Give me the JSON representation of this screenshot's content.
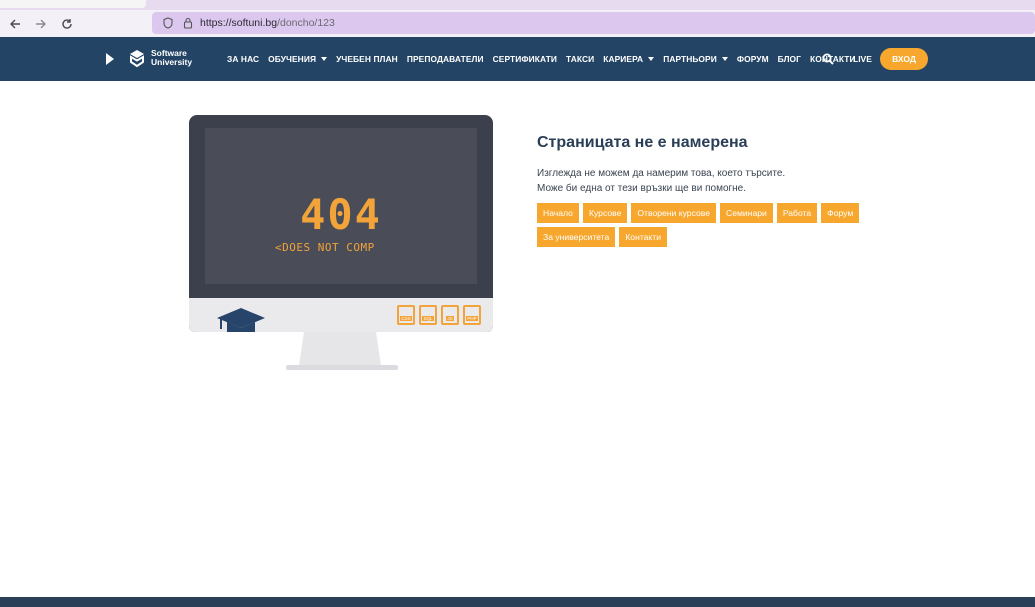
{
  "browser": {
    "url_host": "https://softuni.bg",
    "url_path": "/doncho/123"
  },
  "header": {
    "logo_line1": "Software",
    "logo_line2": "University",
    "nav": [
      {
        "label": "ЗА НАС",
        "dropdown": false
      },
      {
        "label": "ОБУЧЕНИЯ",
        "dropdown": true
      },
      {
        "label": "УЧЕБЕН ПЛАН",
        "dropdown": false
      },
      {
        "label": "ПРЕПОДАВАТЕЛИ",
        "dropdown": false
      },
      {
        "label": "СЕРТИФИКАТИ",
        "dropdown": false
      },
      {
        "label": "ТАКСИ",
        "dropdown": false
      },
      {
        "label": "КАРИЕРА",
        "dropdown": true
      },
      {
        "label": "ПАРТНЬОРИ",
        "dropdown": true
      },
      {
        "label": "ФОРУМ",
        "dropdown": false
      },
      {
        "label": "БЛОГ",
        "dropdown": false
      },
      {
        "label": "КОНТАКТИ",
        "dropdown": false
      }
    ],
    "live_label": "LIVE",
    "login_label": "ВХОД"
  },
  "illustration": {
    "code": "404",
    "subtext": "<DOES NOT COMP",
    "file_types": [
      "CSS",
      "SQL",
      "JS",
      "PHP"
    ]
  },
  "main": {
    "title": "Страницата не е намерена",
    "line1": "Изглежда не можем да намерим това, което търсите.",
    "line2": "Може би една от тези връзки ще ви помогне.",
    "links": [
      "Начало",
      "Курсове",
      "Отворени курсове",
      "Семинари",
      "Работа",
      "Форум",
      "За университета",
      "Контакти"
    ]
  },
  "colors": {
    "header_bg": "#234465",
    "accent": "#f7a72d",
    "title": "#2a3f57"
  }
}
